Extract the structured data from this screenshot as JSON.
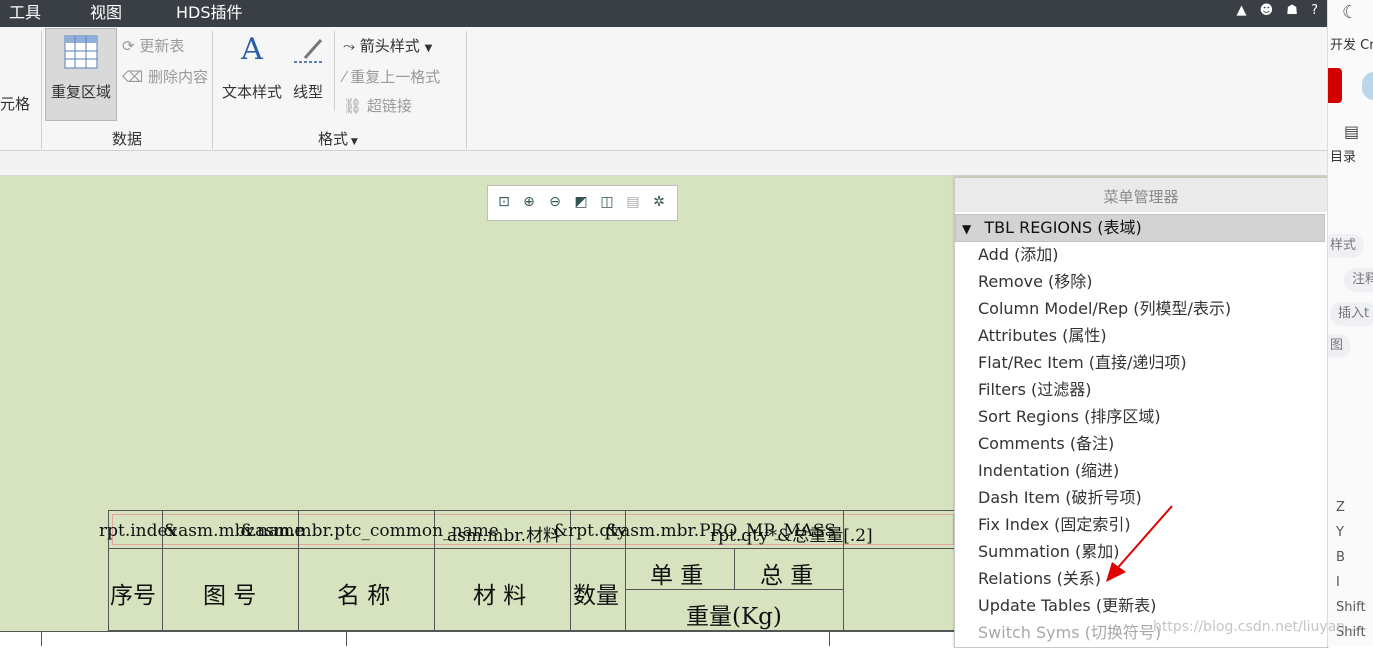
{
  "menubar": {
    "items": [
      "工具",
      "视图",
      "HDS插件"
    ],
    "right_icons": [
      "▲",
      "☻",
      "☗",
      "?"
    ]
  },
  "ribbon": {
    "cut_off_label": "元格",
    "repeat_region_label": "重复区域",
    "update_table_label": "更新表",
    "delete_content_label": "删除内容",
    "group_data_label": "数据",
    "text_style_label": "文本样式",
    "line_style_label": "线型",
    "arrow_style_label": "箭头样式",
    "repeat_last_format_label": "重复上一格式",
    "hyperlink_label": "超链接",
    "group_format_label": "格式"
  },
  "table": {
    "rpt_row": [
      "rpt.index",
      "&asm.mbr.name",
      "&asm.mbr.ptc_common_name",
      "asm.mbr.材料",
      "&rpt.qty",
      "&asm.mbr.PRO_MP_MASS",
      "rpt.qty*&总重量[.2]"
    ],
    "headers": {
      "index": "序号",
      "code": "图 号",
      "name": "名 称",
      "material": "材 料",
      "qty": "数量",
      "unit_weight": "单 重",
      "total_weight": "总 重",
      "weight_kg": "重量(Kg)"
    }
  },
  "menu_manager": {
    "title": "菜单管理器",
    "section": "TBL REGIONS (表域)",
    "items": [
      {
        "label": "Add (添加)"
      },
      {
        "label": "Remove (移除)"
      },
      {
        "label": "Column Model/Rep (列模型/表示)"
      },
      {
        "label": "Attributes (属性)"
      },
      {
        "label": "Flat/Rec Item (直接/递归项)"
      },
      {
        "label": "Filters (过滤器)"
      },
      {
        "label": "Sort Regions (排序区域)"
      },
      {
        "label": "Comments (备注)"
      },
      {
        "label": "Indentation (缩进)"
      },
      {
        "label": "Dash Item (破折号项)"
      },
      {
        "label": "Fix Index (固定索引)"
      },
      {
        "label": "Summation (累加)"
      },
      {
        "label": "Relations (关系)"
      },
      {
        "label": "Update Tables (更新表)"
      },
      {
        "label": "Switch Syms (切换符号)"
      }
    ]
  },
  "side_panel": {
    "dev_label": "开发 Cre",
    "toc_label": "目录",
    "pills": [
      "样式",
      "注释",
      "插入t",
      "图"
    ],
    "shortcuts": [
      "Z",
      "Y",
      "B",
      "I",
      "Shift",
      "Shift"
    ]
  },
  "watermark": "https://blog.csdn.net/liuyan..."
}
